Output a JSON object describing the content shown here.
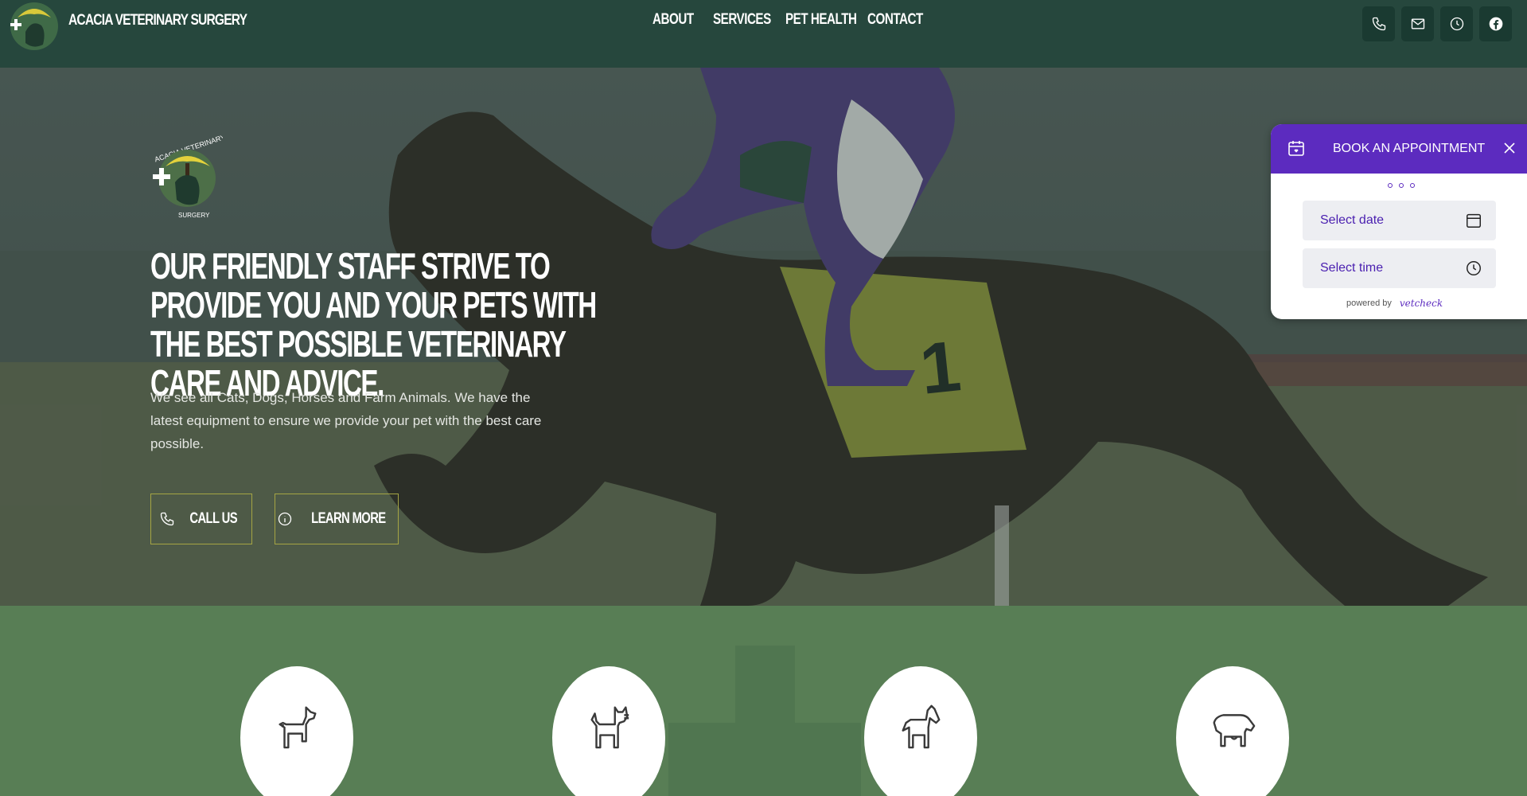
{
  "header": {
    "brand": "ACACIA VETERINARY SURGERY",
    "nav": [
      "ABOUT",
      "SERVICES",
      "PET HEALTH",
      "CONTACT"
    ],
    "icons": [
      "phone-icon",
      "mail-icon",
      "clock-icon",
      "facebook-icon"
    ]
  },
  "hero": {
    "headline": "OUR FRIENDLY STAFF STRIVE TO PROVIDE YOU AND YOUR PETS WITH THE BEST POSSIBLE VETERINARY CARE AND ADVICE.",
    "intro": "We see all Cats, Dogs, Horses and Farm Animals. We have the latest equipment to ensure we provide your pet with the best care possible.",
    "call_label": "CALL US",
    "learn_label": "LEARN MORE",
    "logo_text_top": "ACACIA VETERINARY",
    "logo_text_bottom": "SURGERY"
  },
  "widget": {
    "title": "BOOK AN APPOINTMENT",
    "date_placeholder": "Select date",
    "time_placeholder": "Select time",
    "powered_by": "powered by",
    "brand": "vetcheck"
  },
  "services": {
    "icons": [
      "dog-icon",
      "cat-icon",
      "horse-icon",
      "cow-icon"
    ]
  },
  "colors": {
    "header_bg": "#26473d",
    "accent_green": "#587e55",
    "widget_purple": "#5c2bbf",
    "button_border": "#a5a544"
  }
}
